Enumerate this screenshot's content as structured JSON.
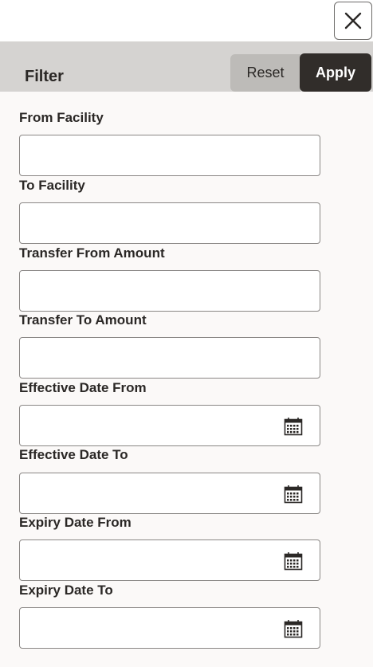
{
  "header": {
    "title": "Filter",
    "reset_label": "Reset",
    "apply_label": "Apply",
    "close_icon": "close-icon"
  },
  "fields": [
    {
      "label": "From Facility",
      "value": "",
      "type": "text"
    },
    {
      "label": "To Facility",
      "value": "",
      "type": "text"
    },
    {
      "label": "Transfer From Amount",
      "value": "",
      "type": "text"
    },
    {
      "label": "Transfer To Amount",
      "value": "",
      "type": "text"
    },
    {
      "label": "Effective Date From",
      "value": "",
      "type": "date",
      "icon": "calendar-icon"
    },
    {
      "label": "Effective Date To",
      "value": "",
      "type": "date",
      "icon": "calendar-icon"
    },
    {
      "label": "Expiry Date From",
      "value": "",
      "type": "date",
      "icon": "calendar-icon"
    },
    {
      "label": "Expiry Date To",
      "value": "",
      "type": "date",
      "icon": "calendar-icon"
    }
  ],
  "colors": {
    "header_bg": "#d5d3d1",
    "apply_bg": "#312d2a",
    "reset_bg": "#bdbbb8",
    "panel_bg": "#fbf9f8",
    "text": "#2b2826"
  }
}
